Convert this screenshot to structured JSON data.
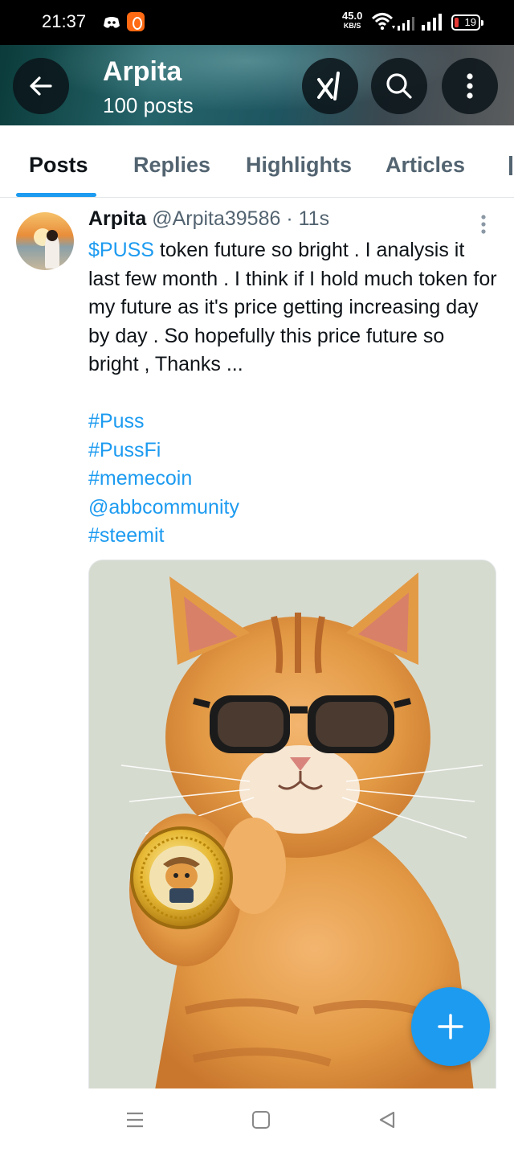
{
  "status_bar": {
    "time": "21:37",
    "net_speed": "45.0",
    "net_unit": "KB/S",
    "battery": "19"
  },
  "header": {
    "name": "Arpita",
    "post_count": "100 posts"
  },
  "tabs": [
    {
      "label": "Posts",
      "active": true
    },
    {
      "label": "Replies"
    },
    {
      "label": "Highlights"
    },
    {
      "label": "Articles"
    }
  ],
  "post": {
    "display_name": "Arpita",
    "handle": "@Arpita39586",
    "separator": " · ",
    "time": "11s",
    "cashtag": "$PUSS",
    "text": " token future so bright . I analysis it last few month . I think if I hold much token for my future as it's price getting increasing day by day . So hopefully this price future so bright , Thanks ...",
    "tags": [
      "#Puss",
      "#PussFi",
      "#memecoin",
      "@abbcommunity",
      "#steemit"
    ]
  },
  "colors": {
    "accent": "#1d9bf0",
    "secondary_text": "#536471",
    "primary_text": "#0f1419"
  }
}
